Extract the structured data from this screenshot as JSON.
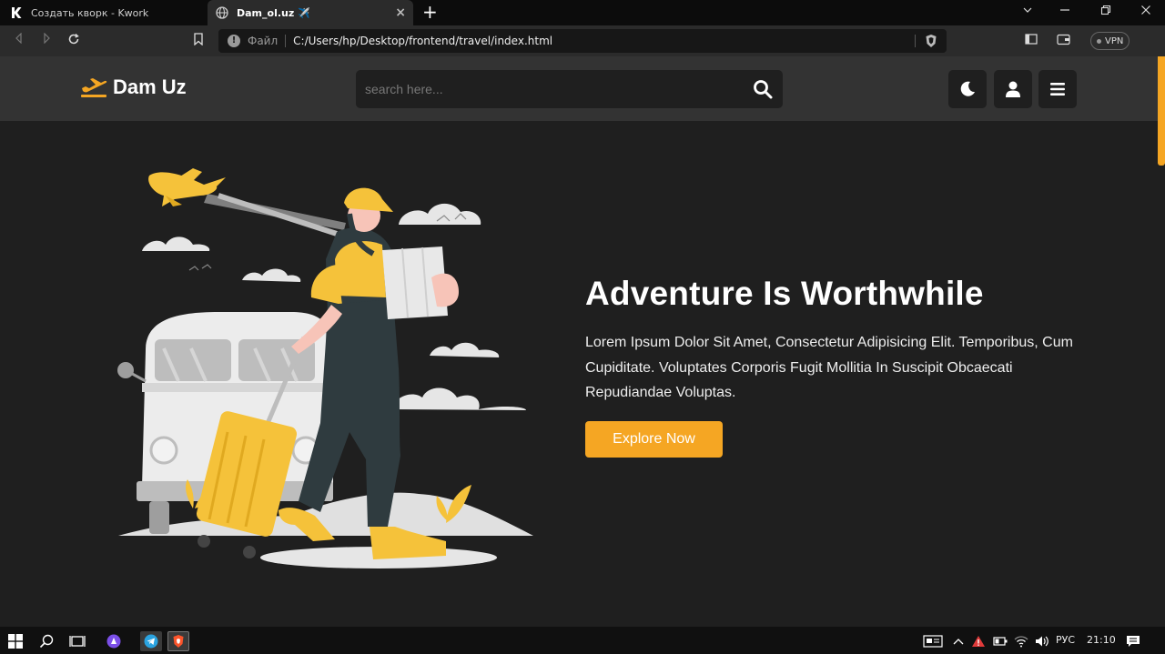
{
  "browser": {
    "tabs": [
      {
        "title": "Создать кворк - Kwork",
        "active": false
      },
      {
        "title": "Dam_ol.uz ✈️",
        "active": true
      }
    ],
    "new_tab": "+",
    "window_controls": [
      "chevron-down-icon",
      "minimize-icon",
      "restore-icon",
      "close-icon"
    ],
    "address": {
      "label": "Файл",
      "url": "C:/Users/hp/Desktop/frontend/travel/index.html"
    },
    "vpn_label": "VPN"
  },
  "site": {
    "brand": "Dam Uz",
    "search": {
      "placeholder": "search here..."
    },
    "header_buttons": [
      "moon-icon",
      "user-icon",
      "menu-icon"
    ],
    "hero": {
      "title": "Adventure Is Worthwhile",
      "text": "Lorem Ipsum Dolor Sit Amet, Consectetur Adipisicing Elit. Temporibus, Cum Cupiditate. Voluptates Corporis Fugit Mollitia In Suscipit Obcaecati Repudiandae Voluptas.",
      "cta_label": "Explore Now"
    },
    "colors": {
      "accent": "#f5a623",
      "background": "#1f1f1f",
      "header": "#333333"
    }
  },
  "taskbar": {
    "language": "РУС",
    "time": "21:10"
  }
}
